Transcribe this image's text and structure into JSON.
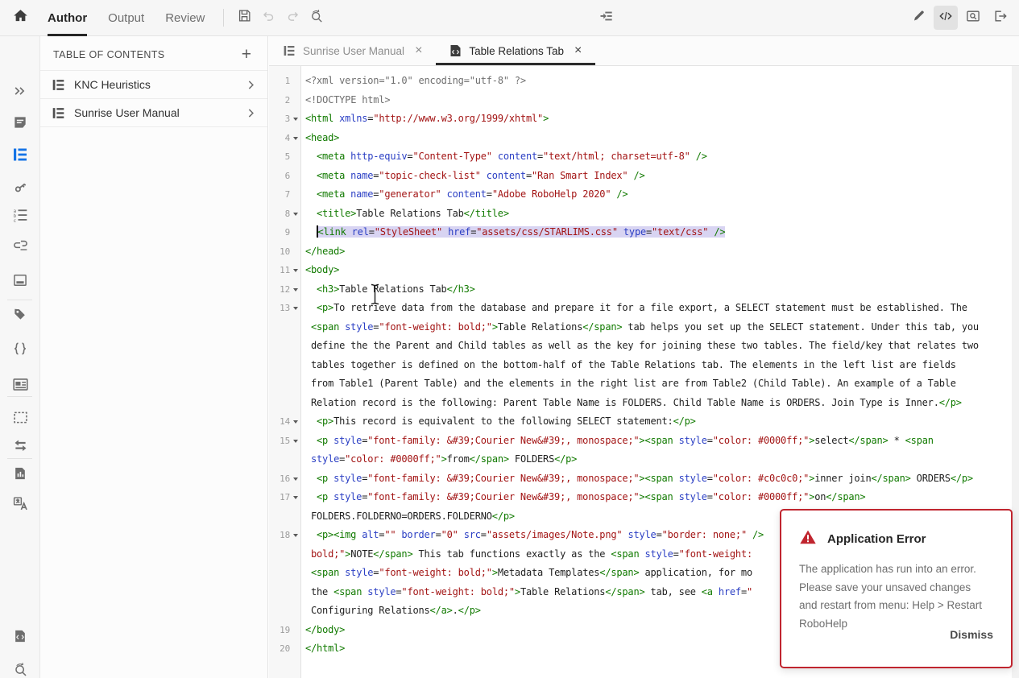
{
  "toolbar": {
    "mode_tabs": [
      {
        "label": "Author",
        "active": true
      },
      {
        "label": "Output",
        "active": false
      },
      {
        "label": "Review",
        "active": false
      }
    ],
    "left_icons": [
      "home"
    ],
    "action_icons": [
      "save",
      "undo",
      "redo",
      "find-replace"
    ],
    "center_icon": "insert-topic",
    "right_icons": [
      {
        "name": "edit-mode",
        "active": false
      },
      {
        "name": "code-view",
        "active": true
      },
      {
        "name": "preview",
        "active": false
      },
      {
        "name": "exit",
        "active": false
      }
    ]
  },
  "sidebar": {
    "rail_icons": [
      "panel-expand",
      "topics",
      "toc",
      "index",
      "glossary",
      "see-also",
      "master-pages",
      "condition-tags",
      "snippets",
      "media",
      "placeholder",
      "swap-review",
      "reports",
      "translate"
    ],
    "rail_bottom_icons": [
      "code-files",
      "scan"
    ],
    "active_icon": "toc"
  },
  "toc_panel": {
    "title": "TABLE OF CONTENTS",
    "add_button": "+",
    "items": [
      {
        "label": "KNC Heuristics"
      },
      {
        "label": "Sunrise User Manual"
      }
    ]
  },
  "doc_tabs": [
    {
      "label": "Sunrise User Manual",
      "icon": "toc",
      "active": false,
      "close": "×"
    },
    {
      "label": "Table Relations Tab",
      "icon": "html-topic",
      "active": true,
      "close": "×"
    }
  ],
  "editor": {
    "rows": [
      {
        "n": "1",
        "t": [
          [
            "g",
            "<?xml version=\"1.0\" encoding=\"utf-8\" ?>"
          ]
        ]
      },
      {
        "n": "2",
        "t": [
          [
            "g",
            "<!DOCTYPE html>"
          ]
        ]
      },
      {
        "n": "3",
        "f": true,
        "t": [
          [
            "t",
            "<html "
          ],
          [
            "a",
            "xmlns"
          ],
          [
            "p",
            "="
          ],
          [
            "s",
            "\"http://www.w3.org/1999/xhtml\""
          ],
          [
            "t",
            ">"
          ]
        ]
      },
      {
        "n": "4",
        "f": true,
        "t": [
          [
            "t",
            "<head>"
          ]
        ]
      },
      {
        "n": "5",
        "i": 2,
        "t": [
          [
            "t",
            "<meta "
          ],
          [
            "a",
            "http-equiv"
          ],
          [
            "p",
            "="
          ],
          [
            "s",
            "\"Content-Type\""
          ],
          [
            "p",
            " "
          ],
          [
            "a",
            "content"
          ],
          [
            "p",
            "="
          ],
          [
            "s",
            "\"text/html; charset=utf-8\""
          ],
          [
            "p",
            " "
          ],
          [
            "t",
            "/>"
          ]
        ]
      },
      {
        "n": "6",
        "i": 2,
        "t": [
          [
            "t",
            "<meta "
          ],
          [
            "a",
            "name"
          ],
          [
            "p",
            "="
          ],
          [
            "s",
            "\"topic-check-list\""
          ],
          [
            "p",
            " "
          ],
          [
            "a",
            "content"
          ],
          [
            "p",
            "="
          ],
          [
            "s",
            "\"Ran Smart Index\""
          ],
          [
            "p",
            " "
          ],
          [
            "t",
            "/>"
          ]
        ]
      },
      {
        "n": "7",
        "i": 2,
        "t": [
          [
            "t",
            "<meta "
          ],
          [
            "a",
            "name"
          ],
          [
            "p",
            "="
          ],
          [
            "s",
            "\"generator\""
          ],
          [
            "p",
            " "
          ],
          [
            "a",
            "content"
          ],
          [
            "p",
            "="
          ],
          [
            "s",
            "\"Adobe RoboHelp 2020\""
          ],
          [
            "p",
            " "
          ],
          [
            "t",
            "/>"
          ]
        ]
      },
      {
        "n": "8",
        "f": true,
        "i": 2,
        "t": [
          [
            "t",
            "<title>"
          ],
          [
            "p",
            "Table Relations Tab"
          ],
          [
            "t",
            "</title>"
          ]
        ]
      },
      {
        "n": "9",
        "i": 2,
        "sel": true,
        "t": [
          [
            "t",
            "<link "
          ],
          [
            "a",
            "rel"
          ],
          [
            "p",
            "="
          ],
          [
            "s",
            "\"StyleSheet\""
          ],
          [
            "p",
            " "
          ],
          [
            "a",
            "href"
          ],
          [
            "p",
            "="
          ],
          [
            "s",
            "\"assets/css/STARLIMS.css\""
          ],
          [
            "p",
            " "
          ],
          [
            "a",
            "type"
          ],
          [
            "p",
            "="
          ],
          [
            "s",
            "\"text/css\""
          ],
          [
            "p",
            " "
          ],
          [
            "t",
            "/>"
          ]
        ]
      },
      {
        "n": "10",
        "t": [
          [
            "t",
            "</head>"
          ]
        ]
      },
      {
        "n": "11",
        "f": true,
        "t": [
          [
            "t",
            "<body>"
          ]
        ]
      },
      {
        "n": "12",
        "f": true,
        "i": 2,
        "t": [
          [
            "t",
            "<h3>"
          ],
          [
            "p",
            "Table Relations Tab"
          ],
          [
            "t",
            "</h3>"
          ]
        ]
      },
      {
        "n": "13",
        "f": true,
        "i": 2,
        "t": [
          [
            "t",
            "<p>"
          ],
          [
            "p",
            "To retrieve data from the database and prepare it for a file export, a SELECT statement must be established. The"
          ]
        ]
      },
      {
        "i": 1,
        "t": [
          [
            "t",
            "<span "
          ],
          [
            "a",
            "style"
          ],
          [
            "p",
            "="
          ],
          [
            "s",
            "\"font-weight: bold;\""
          ],
          [
            "t",
            ">"
          ],
          [
            "p",
            "Table Relations"
          ],
          [
            "t",
            "</span>"
          ],
          [
            "p",
            " tab helps you set up the SELECT statement. Under this tab, you"
          ]
        ]
      },
      {
        "i": 1,
        "t": [
          [
            "p",
            "define the the Parent and Child tables as well as the key for joining these two tables. The field/key that relates two"
          ]
        ]
      },
      {
        "i": 1,
        "t": [
          [
            "p",
            "tables together is defined on the bottom-half of the Table Relations tab. The elements in the left list are fields"
          ]
        ]
      },
      {
        "i": 1,
        "t": [
          [
            "p",
            "from Table1 (Parent Table) and the elements in the right list are from Table2 (Child Table). An example of a Table"
          ]
        ]
      },
      {
        "i": 1,
        "t": [
          [
            "p",
            "Relation record is the following: Parent Table Name is FOLDERS. Child Table Name is ORDERS. Join Type is Inner."
          ],
          [
            "t",
            "</p>"
          ]
        ]
      },
      {
        "n": "14",
        "f": true,
        "i": 2,
        "t": [
          [
            "t",
            "<p>"
          ],
          [
            "p",
            "This record is equivalent to the following SELECT statement:"
          ],
          [
            "t",
            "</p>"
          ]
        ]
      },
      {
        "n": "15",
        "f": true,
        "i": 2,
        "t": [
          [
            "t",
            "<p "
          ],
          [
            "a",
            "style"
          ],
          [
            "p",
            "="
          ],
          [
            "s",
            "\"font-family: &#39;Courier New&#39;, monospace;\""
          ],
          [
            "t",
            "><span "
          ],
          [
            "a",
            "style"
          ],
          [
            "p",
            "="
          ],
          [
            "s",
            "\"color: #0000ff;\""
          ],
          [
            "t",
            ">"
          ],
          [
            "p",
            "select"
          ],
          [
            "t",
            "</span>"
          ],
          [
            "p",
            " * "
          ],
          [
            "t",
            "<span"
          ]
        ]
      },
      {
        "i": 1,
        "t": [
          [
            "a",
            "style"
          ],
          [
            "p",
            "="
          ],
          [
            "s",
            "\"color: #0000ff;\""
          ],
          [
            "t",
            ">"
          ],
          [
            "p",
            "from"
          ],
          [
            "t",
            "</span>"
          ],
          [
            "p",
            " FOLDERS"
          ],
          [
            "t",
            "</p>"
          ]
        ]
      },
      {
        "n": "16",
        "f": true,
        "i": 2,
        "t": [
          [
            "t",
            "<p "
          ],
          [
            "a",
            "style"
          ],
          [
            "p",
            "="
          ],
          [
            "s",
            "\"font-family: &#39;Courier New&#39;, monospace;\""
          ],
          [
            "t",
            "><span "
          ],
          [
            "a",
            "style"
          ],
          [
            "p",
            "="
          ],
          [
            "s",
            "\"color: #c0c0c0;\""
          ],
          [
            "t",
            ">"
          ],
          [
            "p",
            "inner join"
          ],
          [
            "t",
            "</span>"
          ],
          [
            "p",
            " ORDERS"
          ],
          [
            "t",
            "</p>"
          ]
        ]
      },
      {
        "n": "17",
        "f": true,
        "i": 2,
        "t": [
          [
            "t",
            "<p "
          ],
          [
            "a",
            "style"
          ],
          [
            "p",
            "="
          ],
          [
            "s",
            "\"font-family: &#39;Courier New&#39;, monospace;\""
          ],
          [
            "t",
            "><span "
          ],
          [
            "a",
            "style"
          ],
          [
            "p",
            "="
          ],
          [
            "s",
            "\"color: #0000ff;\""
          ],
          [
            "t",
            ">"
          ],
          [
            "p",
            "on"
          ],
          [
            "t",
            "</span>"
          ]
        ]
      },
      {
        "i": 1,
        "t": [
          [
            "p",
            "FOLDERS.FOLDERNO=ORDERS.FOLDERNO"
          ],
          [
            "t",
            "</p>"
          ]
        ]
      },
      {
        "n": "18",
        "f": true,
        "i": 2,
        "t": [
          [
            "t",
            "<p><img "
          ],
          [
            "a",
            "alt"
          ],
          [
            "p",
            "="
          ],
          [
            "s",
            "\"\""
          ],
          [
            "p",
            " "
          ],
          [
            "a",
            "border"
          ],
          [
            "p",
            "="
          ],
          [
            "s",
            "\"0\""
          ],
          [
            "p",
            " "
          ],
          [
            "a",
            "src"
          ],
          [
            "p",
            "="
          ],
          [
            "s",
            "\"assets/images/Note.png\""
          ],
          [
            "p",
            " "
          ],
          [
            "a",
            "style"
          ],
          [
            "p",
            "="
          ],
          [
            "s",
            "\"border: none;\""
          ],
          [
            "p",
            " "
          ],
          [
            "t",
            "/>"
          ]
        ]
      },
      {
        "i": 1,
        "t": [
          [
            "s",
            "bold;\""
          ],
          [
            "t",
            ">"
          ],
          [
            "p",
            "NOTE"
          ],
          [
            "t",
            "</span>"
          ],
          [
            "p",
            " This tab functions exactly as the "
          ],
          [
            "t",
            "<span "
          ],
          [
            "a",
            "style"
          ],
          [
            "p",
            "="
          ],
          [
            "s",
            "\"font-weight:"
          ]
        ]
      },
      {
        "i": 1,
        "t": [
          [
            "t",
            "<span "
          ],
          [
            "a",
            "style"
          ],
          [
            "p",
            "="
          ],
          [
            "s",
            "\"font-weight: bold;\""
          ],
          [
            "t",
            ">"
          ],
          [
            "p",
            "Metadata Templates"
          ],
          [
            "t",
            "</span>"
          ],
          [
            "p",
            " application, for mo"
          ]
        ]
      },
      {
        "i": 1,
        "t": [
          [
            "p",
            "the "
          ],
          [
            "t",
            "<span "
          ],
          [
            "a",
            "style"
          ],
          [
            "p",
            "="
          ],
          [
            "s",
            "\"font-weight: bold;\""
          ],
          [
            "t",
            ">"
          ],
          [
            "p",
            "Table Relations"
          ],
          [
            "t",
            "</span>"
          ],
          [
            "p",
            " tab, see "
          ],
          [
            "t",
            "<a "
          ],
          [
            "a",
            "href"
          ],
          [
            "p",
            "="
          ],
          [
            "s",
            "\""
          ]
        ]
      },
      {
        "i": 1,
        "t": [
          [
            "p",
            "Configuring Relations"
          ],
          [
            "t",
            "</a>"
          ],
          [
            "p",
            "."
          ],
          [
            "t",
            "</p>"
          ]
        ]
      },
      {
        "n": "19",
        "t": [
          [
            "t",
            "</body>"
          ]
        ]
      },
      {
        "n": "20",
        "t": [
          [
            "t",
            "</html>"
          ]
        ]
      }
    ]
  },
  "error_dialog": {
    "icon": "warning-triangle",
    "title": "Application Error",
    "message": "The application has run into an error. Please save your unsaved changes and restart from menu: Help > Restart RoboHelp",
    "dismiss_label": "Dismiss"
  },
  "colors": {
    "accent_blue": "#1473e6",
    "error_red": "#c0252f",
    "selection": "#d8d4f2",
    "code_tag": "#117a00",
    "code_attribute": "#2b3fc4",
    "code_string": "#a31515",
    "code_meta": "#6f6f6f",
    "active_underline": "#2c2c2c"
  }
}
